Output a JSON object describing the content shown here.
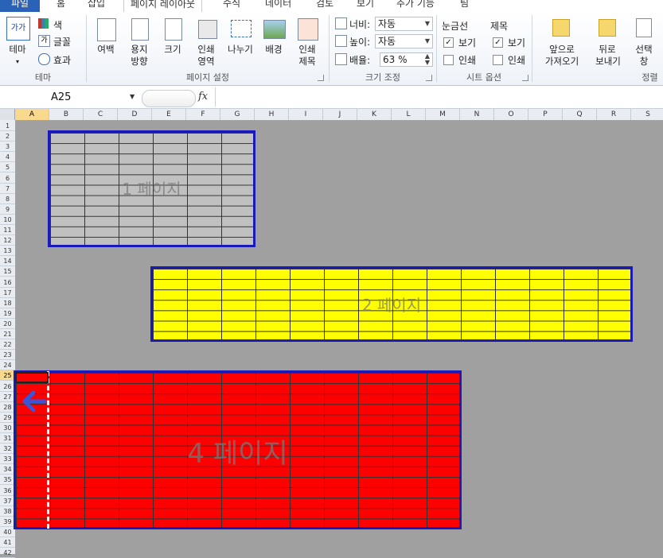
{
  "tabs": [
    {
      "label": "파일",
      "kind": "file"
    },
    {
      "label": "홈"
    },
    {
      "label": "삽입"
    },
    {
      "label": "페이지 레이아웃",
      "active": true
    },
    {
      "label": "수식"
    },
    {
      "label": "데이터"
    },
    {
      "label": "검토"
    },
    {
      "label": "보기"
    },
    {
      "label": "추가 기능"
    },
    {
      "label": "팀"
    }
  ],
  "ribbon": {
    "theme": {
      "group": "테마",
      "main": "테마",
      "main_glyph": "가가",
      "colors": "색",
      "fonts": "글꼴",
      "effects": "효과"
    },
    "page_setup": {
      "group": "페이지 설정",
      "margins": "여백",
      "orientation_1": "용지",
      "orientation_2": "방향",
      "size": "크기",
      "print_area_1": "인쇄",
      "print_area_2": "영역",
      "breaks": "나누기",
      "background": "배경",
      "print_titles_1": "인쇄",
      "print_titles_2": "제목"
    },
    "scale": {
      "group": "크기 조정",
      "width_label": "너비:",
      "width_value": "자동",
      "height_label": "높이:",
      "height_value": "자동",
      "scale_label": "배율:",
      "scale_value": "63 %"
    },
    "sheet_options": {
      "group": "시트 옵션",
      "gridlines": "눈금선",
      "headings": "제목",
      "view": "보기",
      "print": "인쇄",
      "check": "✓"
    },
    "arrange": {
      "group": "정렬",
      "bring_forward_1": "앞으로",
      "bring_forward_2": "가져오기",
      "send_backward_1": "뒤로",
      "send_backward_2": "보내기",
      "selection_pane_1": "선택",
      "selection_pane_2": "창"
    }
  },
  "formula_bar": {
    "name_box": "A25",
    "fx": "fx",
    "value": ""
  },
  "columns": [
    "A",
    "B",
    "C",
    "D",
    "E",
    "F",
    "G",
    "H",
    "I",
    "J",
    "K",
    "L",
    "M",
    "N",
    "O",
    "P",
    "Q",
    "R",
    "S"
  ],
  "selected_cell": {
    "col": "A",
    "row": 25
  },
  "rows": [
    1,
    2,
    3,
    4,
    5,
    6,
    7,
    8,
    9,
    10,
    11,
    12,
    13,
    14,
    15,
    16,
    17,
    18,
    19,
    20,
    21,
    22,
    23,
    24,
    25,
    26,
    27,
    28,
    29,
    30,
    31,
    32,
    33,
    34,
    35,
    36,
    37,
    38,
    39,
    40,
    41,
    42
  ],
  "pages": [
    {
      "label": "1 페이지",
      "fill": "#c0c0c0"
    },
    {
      "label": "2 페이지",
      "fill": "#ffff00"
    },
    {
      "label": "4 페이지",
      "fill": "#ff0000"
    }
  ],
  "colors": {
    "page_border": "#1a1ab8",
    "sheet_bg": "#a0a0a0",
    "selection": "#f9d98e",
    "arrow": "#3b55d9"
  }
}
